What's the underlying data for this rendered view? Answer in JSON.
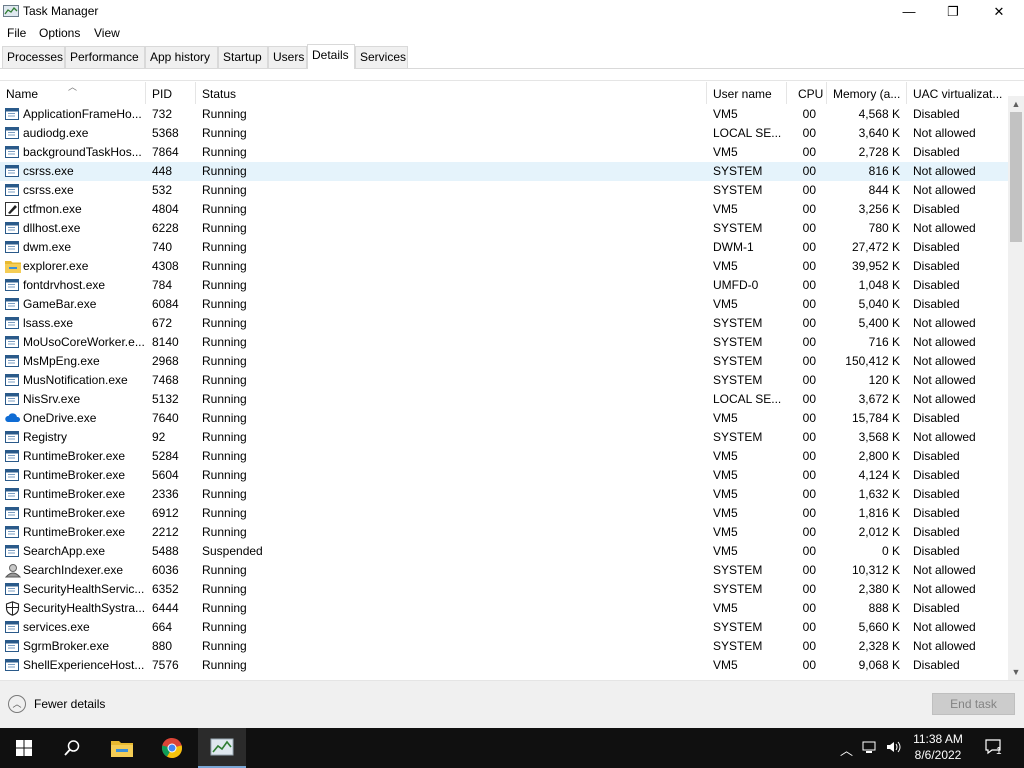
{
  "window": {
    "title": "Task Manager",
    "minimize_glyph": "—",
    "restore_glyph": "❐",
    "close_glyph": "✕"
  },
  "menu": [
    "File",
    "Options",
    "View"
  ],
  "tabs": [
    {
      "label": "Processes"
    },
    {
      "label": "Performance"
    },
    {
      "label": "App history"
    },
    {
      "label": "Startup"
    },
    {
      "label": "Users"
    },
    {
      "label": "Details",
      "active": true
    },
    {
      "label": "Services"
    }
  ],
  "columns": {
    "name": "Name",
    "pid": "PID",
    "status": "Status",
    "user": "User name",
    "cpu": "CPU",
    "memory": "Memory (a...",
    "uac": "UAC virtualizat..."
  },
  "rows": [
    {
      "name": "ApplicationFrameHo...",
      "pid": "732",
      "status": "Running",
      "user": "VM5",
      "cpu": "00",
      "memory": "4,568 K",
      "uac": "Disabled",
      "icon": "window-icon"
    },
    {
      "name": "audiodg.exe",
      "pid": "5368",
      "status": "Running",
      "user": "LOCAL SE...",
      "cpu": "00",
      "memory": "3,640 K",
      "uac": "Not allowed",
      "icon": "window-icon"
    },
    {
      "name": "backgroundTaskHos...",
      "pid": "7864",
      "status": "Running",
      "user": "VM5",
      "cpu": "00",
      "memory": "2,728 K",
      "uac": "Disabled",
      "icon": "window-icon"
    },
    {
      "name": "csrss.exe",
      "pid": "448",
      "status": "Running",
      "user": "SYSTEM",
      "cpu": "00",
      "memory": "816 K",
      "uac": "Not allowed",
      "icon": "window-icon",
      "selected": true
    },
    {
      "name": "csrss.exe",
      "pid": "532",
      "status": "Running",
      "user": "SYSTEM",
      "cpu": "00",
      "memory": "844 K",
      "uac": "Not allowed",
      "icon": "window-icon"
    },
    {
      "name": "ctfmon.exe",
      "pid": "4804",
      "status": "Running",
      "user": "VM5",
      "cpu": "00",
      "memory": "3,256 K",
      "uac": "Disabled",
      "icon": "pen-icon"
    },
    {
      "name": "dllhost.exe",
      "pid": "6228",
      "status": "Running",
      "user": "SYSTEM",
      "cpu": "00",
      "memory": "780 K",
      "uac": "Not allowed",
      "icon": "window-icon"
    },
    {
      "name": "dwm.exe",
      "pid": "740",
      "status": "Running",
      "user": "DWM-1",
      "cpu": "00",
      "memory": "27,472 K",
      "uac": "Disabled",
      "icon": "window-icon"
    },
    {
      "name": "explorer.exe",
      "pid": "4308",
      "status": "Running",
      "user": "VM5",
      "cpu": "00",
      "memory": "39,952 K",
      "uac": "Disabled",
      "icon": "folder-icon"
    },
    {
      "name": "fontdrvhost.exe",
      "pid": "784",
      "status": "Running",
      "user": "UMFD-0",
      "cpu": "00",
      "memory": "1,048 K",
      "uac": "Disabled",
      "icon": "window-icon"
    },
    {
      "name": "GameBar.exe",
      "pid": "6084",
      "status": "Running",
      "user": "VM5",
      "cpu": "00",
      "memory": "5,040 K",
      "uac": "Disabled",
      "icon": "window-icon"
    },
    {
      "name": "lsass.exe",
      "pid": "672",
      "status": "Running",
      "user": "SYSTEM",
      "cpu": "00",
      "memory": "5,400 K",
      "uac": "Not allowed",
      "icon": "window-icon"
    },
    {
      "name": "MoUsoCoreWorker.e...",
      "pid": "8140",
      "status": "Running",
      "user": "SYSTEM",
      "cpu": "00",
      "memory": "716 K",
      "uac": "Not allowed",
      "icon": "window-icon"
    },
    {
      "name": "MsMpEng.exe",
      "pid": "2968",
      "status": "Running",
      "user": "SYSTEM",
      "cpu": "00",
      "memory": "150,412 K",
      "uac": "Not allowed",
      "icon": "window-icon"
    },
    {
      "name": "MusNotification.exe",
      "pid": "7468",
      "status": "Running",
      "user": "SYSTEM",
      "cpu": "00",
      "memory": "120 K",
      "uac": "Not allowed",
      "icon": "window-icon"
    },
    {
      "name": "NisSrv.exe",
      "pid": "5132",
      "status": "Running",
      "user": "LOCAL SE...",
      "cpu": "00",
      "memory": "3,672 K",
      "uac": "Not allowed",
      "icon": "window-icon"
    },
    {
      "name": "OneDrive.exe",
      "pid": "7640",
      "status": "Running",
      "user": "VM5",
      "cpu": "00",
      "memory": "15,784 K",
      "uac": "Disabled",
      "icon": "cloud-icon"
    },
    {
      "name": "Registry",
      "pid": "92",
      "status": "Running",
      "user": "SYSTEM",
      "cpu": "00",
      "memory": "3,568 K",
      "uac": "Not allowed",
      "icon": "window-icon"
    },
    {
      "name": "RuntimeBroker.exe",
      "pid": "5284",
      "status": "Running",
      "user": "VM5",
      "cpu": "00",
      "memory": "2,800 K",
      "uac": "Disabled",
      "icon": "window-icon"
    },
    {
      "name": "RuntimeBroker.exe",
      "pid": "5604",
      "status": "Running",
      "user": "VM5",
      "cpu": "00",
      "memory": "4,124 K",
      "uac": "Disabled",
      "icon": "window-icon"
    },
    {
      "name": "RuntimeBroker.exe",
      "pid": "2336",
      "status": "Running",
      "user": "VM5",
      "cpu": "00",
      "memory": "1,632 K",
      "uac": "Disabled",
      "icon": "window-icon"
    },
    {
      "name": "RuntimeBroker.exe",
      "pid": "6912",
      "status": "Running",
      "user": "VM5",
      "cpu": "00",
      "memory": "1,816 K",
      "uac": "Disabled",
      "icon": "window-icon"
    },
    {
      "name": "RuntimeBroker.exe",
      "pid": "2212",
      "status": "Running",
      "user": "VM5",
      "cpu": "00",
      "memory": "2,012 K",
      "uac": "Disabled",
      "icon": "window-icon"
    },
    {
      "name": "SearchApp.exe",
      "pid": "5488",
      "status": "Suspended",
      "user": "VM5",
      "cpu": "00",
      "memory": "0 K",
      "uac": "Disabled",
      "icon": "window-icon"
    },
    {
      "name": "SearchIndexer.exe",
      "pid": "6036",
      "status": "Running",
      "user": "SYSTEM",
      "cpu": "00",
      "memory": "10,312 K",
      "uac": "Not allowed",
      "icon": "search-indexer-icon"
    },
    {
      "name": "SecurityHealthServic...",
      "pid": "6352",
      "status": "Running",
      "user": "SYSTEM",
      "cpu": "00",
      "memory": "2,380 K",
      "uac": "Not allowed",
      "icon": "window-icon"
    },
    {
      "name": "SecurityHealthSystra...",
      "pid": "6444",
      "status": "Running",
      "user": "VM5",
      "cpu": "00",
      "memory": "888 K",
      "uac": "Disabled",
      "icon": "shield-icon"
    },
    {
      "name": "services.exe",
      "pid": "664",
      "status": "Running",
      "user": "SYSTEM",
      "cpu": "00",
      "memory": "5,660 K",
      "uac": "Not allowed",
      "icon": "window-icon"
    },
    {
      "name": "SgrmBroker.exe",
      "pid": "880",
      "status": "Running",
      "user": "SYSTEM",
      "cpu": "00",
      "memory": "2,328 K",
      "uac": "Not allowed",
      "icon": "window-icon"
    },
    {
      "name": "ShellExperienceHost....",
      "pid": "7576",
      "status": "Running",
      "user": "VM5",
      "cpu": "00",
      "memory": "9,068 K",
      "uac": "Disabled",
      "icon": "window-icon"
    }
  ],
  "footer": {
    "fewer_details": "Fewer details",
    "end_task": "End task"
  },
  "taskbar": {
    "time": "11:38 AM",
    "date": "8/6/2022",
    "notification_count": "1"
  }
}
